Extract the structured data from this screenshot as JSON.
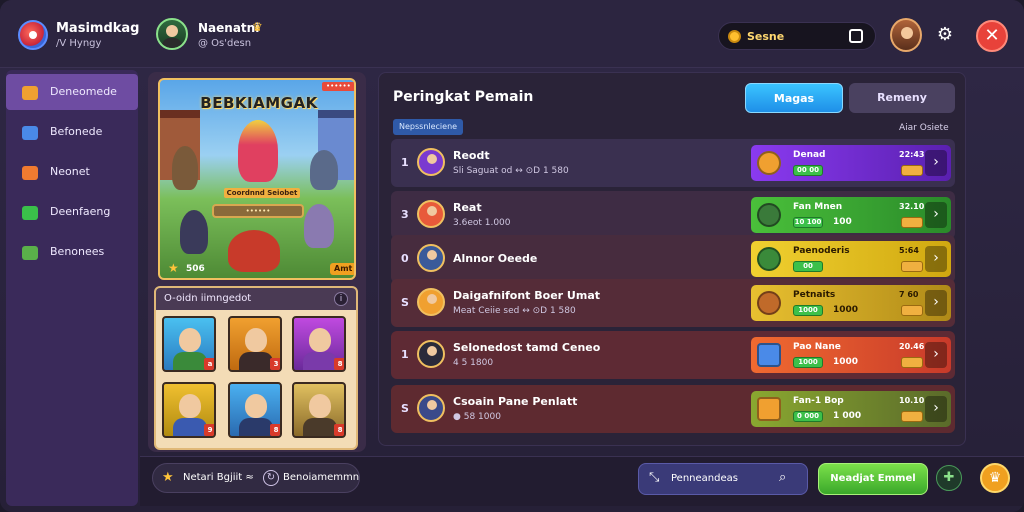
{
  "header": {
    "app_name": "Masimdkag",
    "app_subtitle": "/V Hyngy",
    "user_name": "Naenatni",
    "user_level": "@ Os'desn",
    "coins": "Sesne",
    "crown_icon": "crown-icon",
    "settings_icon": "gear-icon",
    "close_icon": "close-icon"
  },
  "sidebar": {
    "items": [
      {
        "label": "Deneomede",
        "icon": "shield-icon",
        "color": "#f0a030",
        "active": true
      },
      {
        "label": "Befonede",
        "icon": "map-icon",
        "color": "#4a8ae8",
        "active": false
      },
      {
        "label": "Neonet",
        "icon": "mail-icon",
        "color": "#f07a30",
        "active": false
      },
      {
        "label": "Deenfaeng",
        "icon": "chat-icon",
        "color": "#3ac04a",
        "active": false
      },
      {
        "label": "Benonees",
        "icon": "folder-icon",
        "color": "#5ab04a",
        "active": false
      }
    ]
  },
  "event": {
    "banner_title": "BEBKIAMGAK",
    "banner_tag": "••••••",
    "ribbon_text": "Coordnnd Seiobet",
    "progress_text": "••••••",
    "count": "506",
    "timer": "Amt",
    "rewards_title": "O-oidn iimngedot",
    "rewards_info": "i",
    "reward_badges": [
      "a",
      "3",
      "8",
      "9",
      "8",
      "8"
    ]
  },
  "leaderboard": {
    "title": "Peringkat Pemain",
    "tabs": [
      "Magas",
      "Remeny"
    ],
    "filter": "Nepssnleciene",
    "column_head": "Aiar Osiete",
    "rows": [
      {
        "rank": "1",
        "name": "Reodt",
        "stats": "Sli Saguat od ↔ ⊙D 1 580",
        "score_label": "Denad",
        "pill": "00 00",
        "points": "",
        "delta": "22:43",
        "theme": "purple"
      },
      {
        "rank": "3",
        "name": "Reat",
        "stats": "3.6eot 1.000",
        "score_label": "Fan Mnen",
        "pill": "10 100",
        "points": "100",
        "delta": "32.10",
        "theme": "green"
      },
      {
        "rank": "0",
        "name": "Alnnor Oeede",
        "stats": "",
        "score_label": "Paenoderis",
        "pill": "00",
        "points": "",
        "delta": "5:64",
        "theme": "yellow"
      },
      {
        "rank": "S",
        "name": "Daigafnifont Boer Umat",
        "stats": "Meat Ceiie sed ↔ ⊙D 1 580",
        "score_label": "Petnaits",
        "pill": "1000",
        "points": "1000",
        "delta": "7 60",
        "theme": "yellow2"
      },
      {
        "rank": "1",
        "name": "Selonedost tamd Ceneo",
        "stats": "4 5 1800",
        "score_label": "Pao Nane",
        "pill": "1000",
        "points": "1000",
        "delta": "20.46",
        "theme": "red"
      },
      {
        "rank": "S",
        "name": "Csoain Pane Penlatt",
        "stats": "● 58 1000",
        "score_label": "Fan-1 Bop",
        "pill": "0 000",
        "points": "1 000",
        "delta": "10.10",
        "theme": "olive"
      }
    ]
  },
  "footer": {
    "season_label": "Netari Bgjiit ≈",
    "season_ref": "Benoiamemmn",
    "search_label": "Penneandeas",
    "cta": "Neadjat Emmel",
    "chat_icon": "chat-bubble-icon",
    "trophy_icon": "trophy-icon"
  },
  "colors": {
    "accent_blue": "#1f8fe8",
    "accent_green": "#3aa82a",
    "close_red": "#e8423a",
    "sidebar_active": "#6e4ca2"
  }
}
